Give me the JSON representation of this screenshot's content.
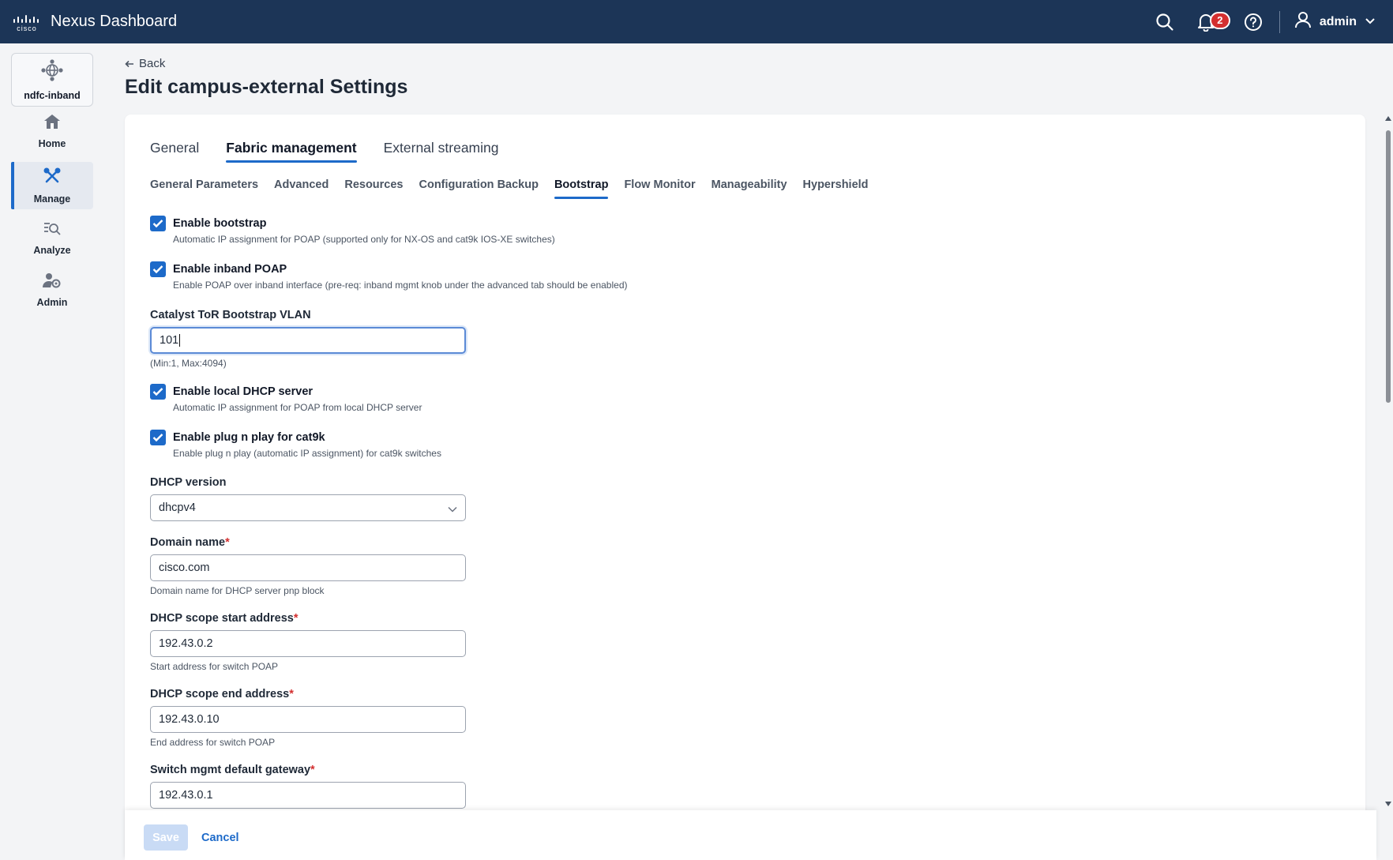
{
  "app": {
    "brand_word": "cisco",
    "title": "Nexus Dashboard"
  },
  "topbar": {
    "notification_count": "2",
    "user_name": "admin"
  },
  "sidebar": {
    "site_name": "ndfc-inband",
    "items": [
      {
        "label": "Home",
        "icon": "home-icon"
      },
      {
        "label": "Manage",
        "icon": "tools-icon",
        "active": true
      },
      {
        "label": "Analyze",
        "icon": "analyze-icon"
      },
      {
        "label": "Admin",
        "icon": "admin-icon"
      }
    ]
  },
  "header": {
    "back_label": "Back",
    "title": "Edit campus-external Settings"
  },
  "tabs": [
    {
      "label": "General"
    },
    {
      "label": "Fabric management",
      "active": true
    },
    {
      "label": "External streaming"
    }
  ],
  "subtabs": [
    {
      "label": "General Parameters"
    },
    {
      "label": "Advanced"
    },
    {
      "label": "Resources"
    },
    {
      "label": "Configuration Backup"
    },
    {
      "label": "Bootstrap",
      "active": true
    },
    {
      "label": "Flow Monitor"
    },
    {
      "label": "Manageability"
    },
    {
      "label": "Hypershield"
    }
  ],
  "form": {
    "enable_bootstrap": {
      "label": "Enable bootstrap",
      "help": "Automatic IP assignment for POAP (supported only for NX-OS and cat9k IOS-XE switches)",
      "checked": true
    },
    "enable_inband_poap": {
      "label": "Enable inband POAP",
      "help": "Enable POAP over inband interface (pre-req: inband mgmt knob under the advanced tab should be enabled)",
      "checked": true
    },
    "tor_vlan": {
      "label": "Catalyst ToR Bootstrap VLAN",
      "value": "101",
      "help": "(Min:1, Max:4094)"
    },
    "enable_local_dhcp": {
      "label": "Enable local DHCP server",
      "help": "Automatic IP assignment for POAP from local DHCP server",
      "checked": true
    },
    "enable_pnp": {
      "label": "Enable plug n play for cat9k",
      "help": "Enable plug n play (automatic IP assignment) for cat9k switches",
      "checked": true
    },
    "dhcp_version": {
      "label": "DHCP version",
      "value": "dhcpv4"
    },
    "domain_name": {
      "label": "Domain name",
      "required": "*",
      "value": "cisco.com",
      "help": "Domain name for DHCP server pnp block"
    },
    "scope_start": {
      "label": "DHCP scope start address",
      "required": "*",
      "value": "192.43.0.2",
      "help": "Start address for switch POAP"
    },
    "scope_end": {
      "label": "DHCP scope end address",
      "required": "*",
      "value": "192.43.0.10",
      "help": "End address for switch POAP"
    },
    "mgmt_gateway": {
      "label": "Switch mgmt default gateway",
      "required": "*",
      "value": "192.43.0.1"
    }
  },
  "footer": {
    "save_label": "Save",
    "cancel_label": "Cancel"
  },
  "colors": {
    "topbar": "#1c3557",
    "accent": "#1d6ac9",
    "required": "#d32f2f"
  }
}
